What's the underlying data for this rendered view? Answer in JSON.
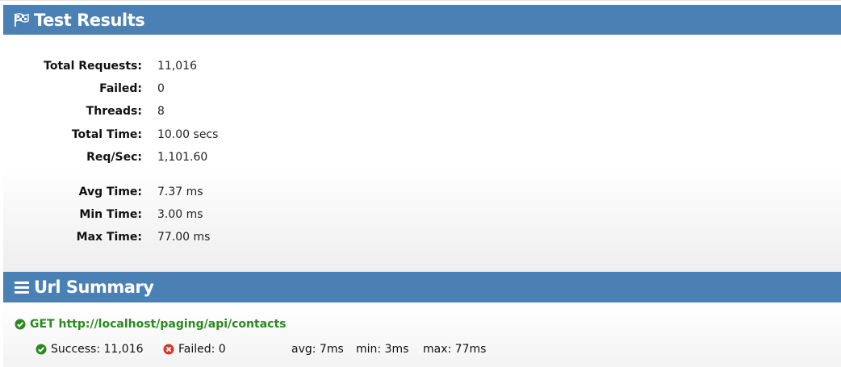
{
  "test_results": {
    "title": "Test Results",
    "icon": "checkered-flag-icon",
    "stats": [
      {
        "label": "Total Requests:",
        "value": "11,016"
      },
      {
        "label": "Failed:",
        "value": "0"
      },
      {
        "label": "Threads:",
        "value": "8"
      },
      {
        "label": "Total Time:",
        "value": "10.00 secs"
      },
      {
        "label": "Req/Sec:",
        "value": "1,101.60"
      },
      {
        "label": "Avg Time:",
        "value": "7.37 ms"
      },
      {
        "label": "Min Time:",
        "value": "3.00 ms"
      },
      {
        "label": "Max Time:",
        "value": "77.00 ms"
      }
    ]
  },
  "url_summary": {
    "title": "Url Summary",
    "icon": "list-icon",
    "url": "GET http://localhost/paging/api/contacts",
    "success": "Success: 11,016",
    "failed": "Failed: 0",
    "avg": "avg: 7ms",
    "min": "min: 3ms",
    "max": "max: 77ms"
  },
  "colors": {
    "header_bar": "#4a80b4",
    "success_green": "#2a8a1f",
    "failed_red": "#d9342b"
  }
}
